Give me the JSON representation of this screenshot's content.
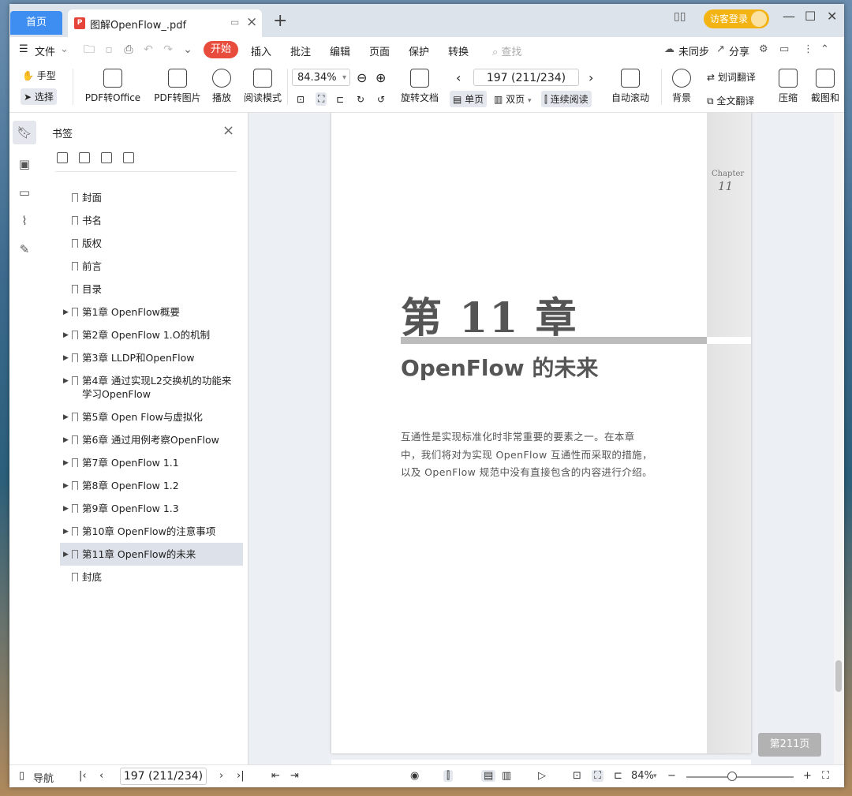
{
  "titlebar": {
    "home_tab": "首页",
    "doc_tab": "图解OpenFlow_.pdf",
    "pdf_badge": "P",
    "new_tab": "+",
    "login": "访客登录",
    "window_controls": [
      "minimize-icon",
      "maximize-icon",
      "close-icon"
    ]
  },
  "menubar": {
    "file": "文件",
    "items": [
      "开始",
      "插入",
      "批注",
      "编辑",
      "页面",
      "保护",
      "转换"
    ],
    "search_placeholder": "查找",
    "sync": "未同步",
    "share": "分享"
  },
  "toolbar": {
    "hand": "手型",
    "select": "选择",
    "pdf_to_office": "PDF转Office",
    "pdf_to_image": "PDF转图片",
    "play": "播放",
    "read_mode": "阅读模式",
    "zoom": "84.34%",
    "page_nav": "197 (211/234)",
    "rotate": "旋转文档",
    "single": "单页",
    "double": "双页",
    "continuous": "连续阅读",
    "auto_scroll": "自动滚动",
    "background": "背景",
    "word_translate": "划词翻译",
    "full_translate": "全文翻译",
    "compress": "压缩",
    "screenshot": "截图和"
  },
  "bookmark_panel": {
    "title": "书签",
    "items": [
      {
        "label": "封面",
        "expandable": false
      },
      {
        "label": "书名",
        "expandable": false
      },
      {
        "label": "版权",
        "expandable": false
      },
      {
        "label": "前言",
        "expandable": false
      },
      {
        "label": "目录",
        "expandable": false
      },
      {
        "label": "第1章  OpenFlow概要",
        "expandable": true
      },
      {
        "label": "第2章  OpenFlow 1.O的机制",
        "expandable": true
      },
      {
        "label": "第3章  LLDP和OpenFlow",
        "expandable": true
      },
      {
        "label": "第4章  通过实现L2交换机的功能来学习OpenFlow",
        "expandable": true
      },
      {
        "label": "第5章  Open Flow与虚拟化",
        "expandable": true
      },
      {
        "label": "第6章  通过用例考察OpenFlow",
        "expandable": true
      },
      {
        "label": "第7章  OpenFlow 1.1",
        "expandable": true
      },
      {
        "label": "第8章  OpenFlow 1.2",
        "expandable": true
      },
      {
        "label": "第9章  OpenFlow 1.3",
        "expandable": true
      },
      {
        "label": "第10章  OpenFlow的注意事项",
        "expandable": true
      },
      {
        "label": "第11章  OpenFlow的未来",
        "expandable": true,
        "active": true
      },
      {
        "label": "封底",
        "expandable": false
      }
    ]
  },
  "page": {
    "chapter_en": "Chapter",
    "chapter_num": "11",
    "chapter_title": "第 11 章",
    "subtitle": "OpenFlow 的未来",
    "intro": "互通性是实现标准化时非常重要的要素之一。在本章中，我们将对为实现 OpenFlow 互通性而采取的措施，以及 OpenFlow 规范中没有直接包含的内容进行介绍。",
    "page_badge": "第211页"
  },
  "statusbar": {
    "nav": "导航",
    "page": "197 (211/234)",
    "zoom": "84%"
  }
}
